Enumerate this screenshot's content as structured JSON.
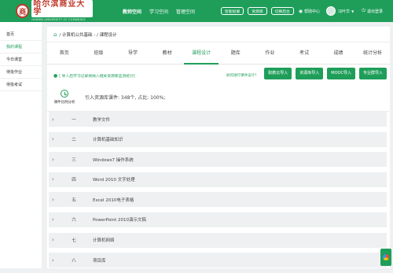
{
  "header": {
    "logo_text": "哈尔滨商业大学",
    "logo_en": "HARBIN UNIVERSITY OF COMMERCE",
    "logo_seal": "商",
    "nav": [
      "教师空间",
      "学习空间",
      "管理空间"
    ],
    "pills": [
      "智能投屏",
      "资源库",
      "切换后台"
    ],
    "help": "帮助中心",
    "user": "冯叶华",
    "logout": "退出登录"
  },
  "sidebar": {
    "items": [
      "首页",
      "我的课程",
      "今日课堂",
      "待批作业",
      "待批考试"
    ]
  },
  "breadcrumb": {
    "text": "/ 计算机公共基础 - / 课程设计"
  },
  "tabs": [
    "首页",
    "班级",
    "导学",
    "教材",
    "课程设计",
    "题库",
    "作业",
    "考试",
    "成绩",
    "统计分析"
  ],
  "notice": {
    "text": "[ 导入后学习记录将纳入相关资源库监测统计]",
    "help_link": "如何进行课件设计?",
    "buttons": [
      "职教云导入",
      "资源库导入",
      "MOOC导入",
      "专业群导入"
    ]
  },
  "stats": {
    "label": "课件比例分析",
    "text": "引入资源库课件: 348个, 占比: 100%;"
  },
  "chapters": [
    {
      "num": "一",
      "title": "教学文件"
    },
    {
      "num": "二",
      "title": "计算机基础知识"
    },
    {
      "num": "三",
      "title": "Windows7 操作系统"
    },
    {
      "num": "四",
      "title": "Word 2010 文字处理"
    },
    {
      "num": "五",
      "title": "Excel 2010电子表格"
    },
    {
      "num": "六",
      "title": "PowerPoint 2010演示文稿"
    },
    {
      "num": "七",
      "title": "计算机网络"
    },
    {
      "num": "八",
      "title": "项目库"
    }
  ],
  "colors": {
    "accent": "#1f9e5a",
    "panel": "#eef0f2"
  }
}
